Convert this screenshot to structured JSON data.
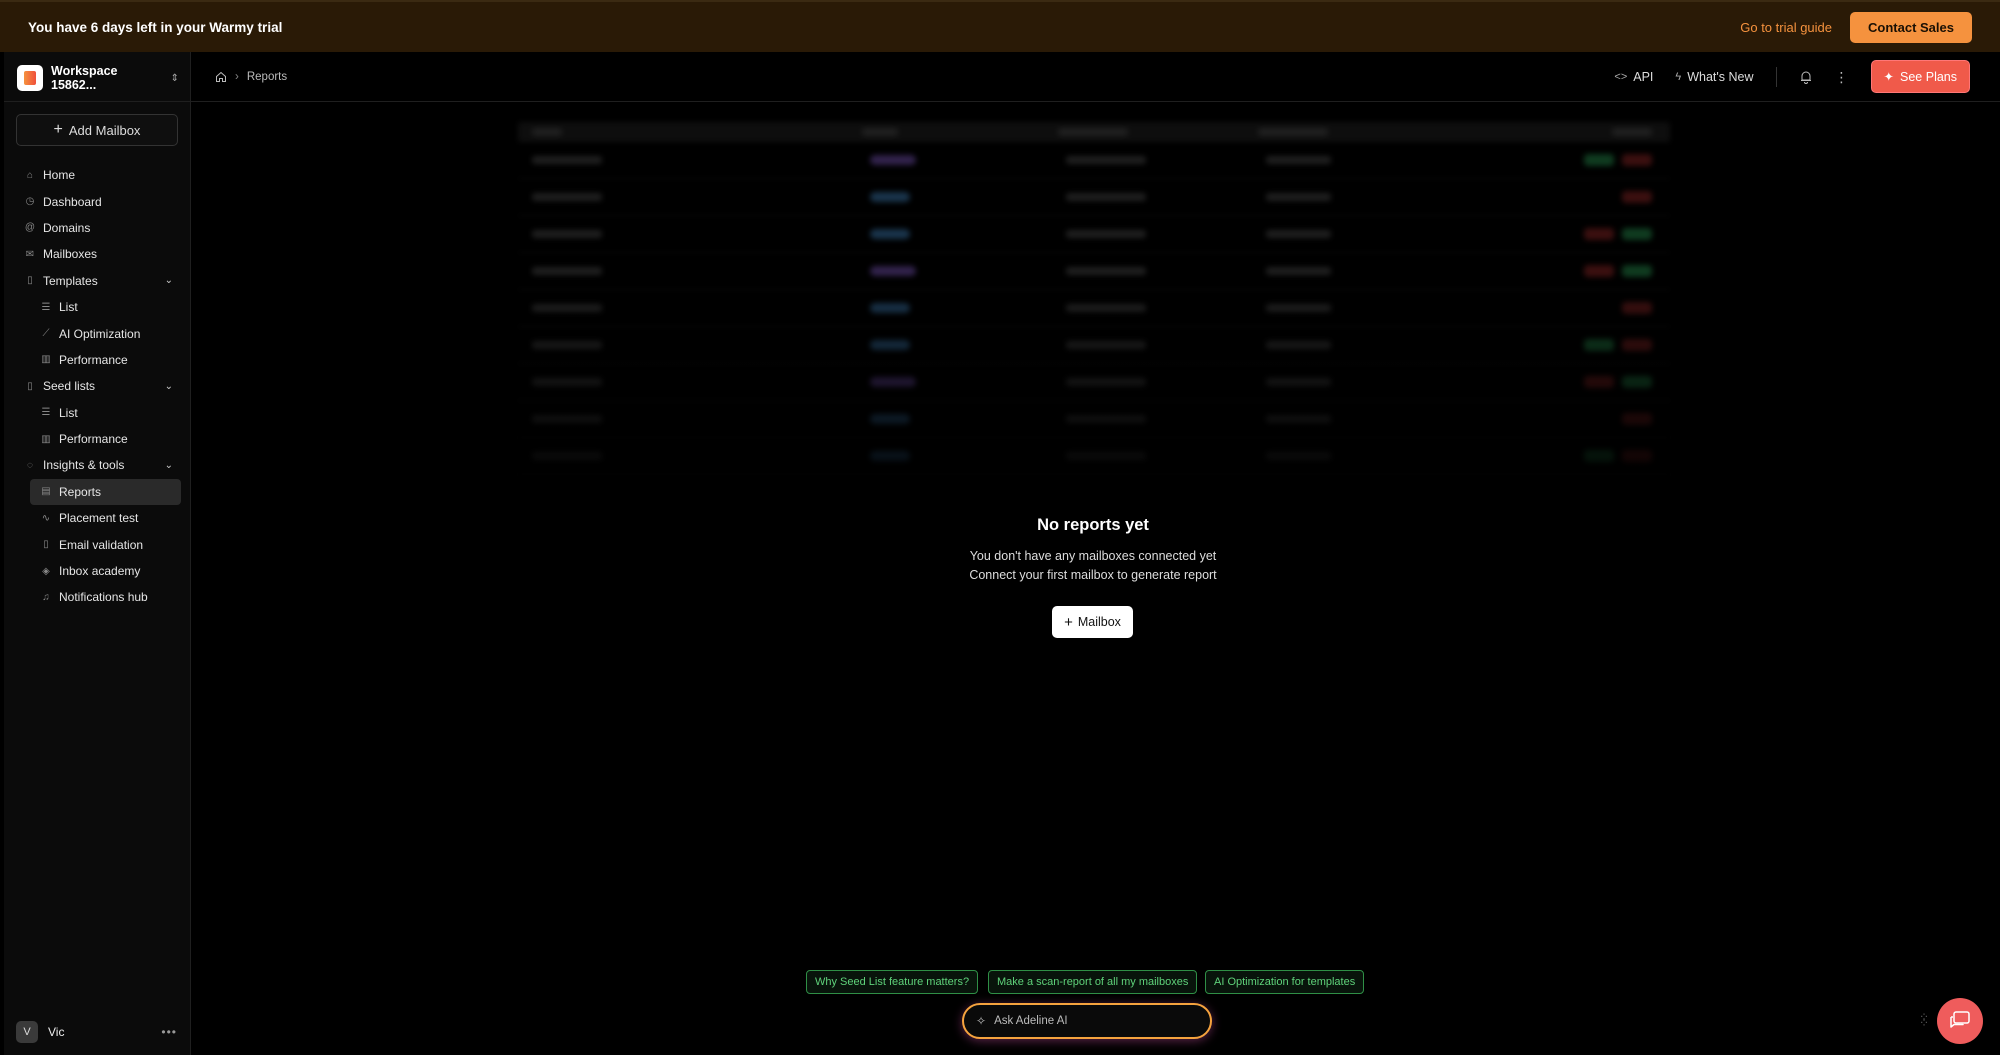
{
  "banner": {
    "message": "You have 6 days left in your Warmy trial",
    "guide_label": "Go to trial guide",
    "sales_label": "Contact Sales"
  },
  "workspace": {
    "name": "Workspace 15862..."
  },
  "sidebar": {
    "add_mailbox_label": "Add Mailbox",
    "items": [
      {
        "label": "Home"
      },
      {
        "label": "Dashboard"
      },
      {
        "label": "Domains"
      },
      {
        "label": "Mailboxes"
      },
      {
        "label": "Templates"
      },
      {
        "label": "List"
      },
      {
        "label": "AI Optimization"
      },
      {
        "label": "Performance"
      },
      {
        "label": "Seed lists"
      },
      {
        "label": "List"
      },
      {
        "label": "Performance"
      },
      {
        "label": "Insights & tools"
      },
      {
        "label": "Reports"
      },
      {
        "label": "Placement test"
      },
      {
        "label": "Email validation"
      },
      {
        "label": "Inbox academy"
      },
      {
        "label": "Notifications hub"
      }
    ]
  },
  "user": {
    "initial": "V",
    "name": "Vic"
  },
  "header": {
    "breadcrumb": "Reports",
    "api_label": "API",
    "whats_new_label": "What's New",
    "plans_label": "See Plans"
  },
  "empty_state": {
    "title": "No reports yet",
    "line1": "You don't have any mailboxes connected yet",
    "line2": "Connect your first mailbox to generate report",
    "button_label": "Mailbox"
  },
  "suggestions": [
    "Why Seed List feature matters?",
    "Make a scan-report of all my mailboxes",
    "AI Optimization for templates"
  ],
  "ai": {
    "placeholder": "Ask Adeline AI"
  },
  "colors": {
    "accent_orange": "#f5923e",
    "plans_red": "#f05a4a",
    "suggestion_green": "#5fd27a"
  }
}
